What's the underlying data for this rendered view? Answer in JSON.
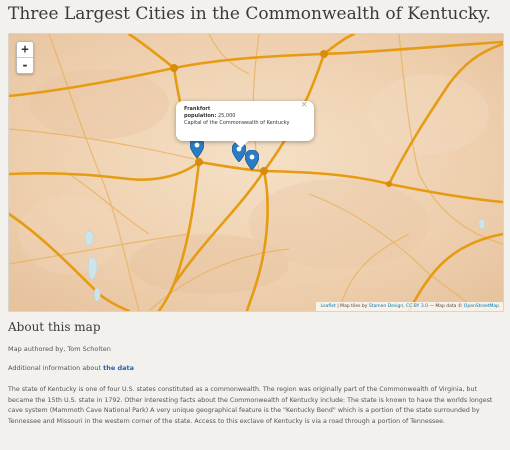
{
  "page": {
    "title": "Three Largest Cities in the Commonwealth of Kentucky."
  },
  "map": {
    "zoom_in_label": "+",
    "zoom_out_label": "-",
    "marker_icon": "map-pin-icon",
    "marker_color": "#2a7dc4",
    "road_color": "#e6a21f",
    "popup": {
      "city": "Frankfort",
      "population_label": "population:",
      "population_value": "25,000",
      "caption": "Capital of the Commonwealth of Kentucky",
      "close_label": "×"
    },
    "attribution": {
      "leaflet": "Leaflet",
      "text": "| Map tiles by",
      "stamen": "Stamen Design, CC BY 3.0",
      "data_text": "— Map data ©",
      "osm": "OpenStreetMap"
    }
  },
  "about": {
    "heading": "About this map",
    "authored": "Map authored by, Tom Scholten",
    "additional_prefix": "Additional information about",
    "additional_link": "the data",
    "description": "The state of Kentucky is one of four U.S. states constituted as a commonwealth. The region was originally part of the Commonwealth of Virginia, but became the 15th U.S. state in 1792. Other interesting facts about the Commonwealth of Kentucky include: The state is known to have the worlds longest cave system (Mammoth Cave National Park) A very unique geographical feature is the \"Kentucky Bend\" which is a portion of the state surrounded by Tennessee and Missouri in the western corner of the state. Access to this exclave of Kentucky is via a road through a portion of Tennessee."
  }
}
